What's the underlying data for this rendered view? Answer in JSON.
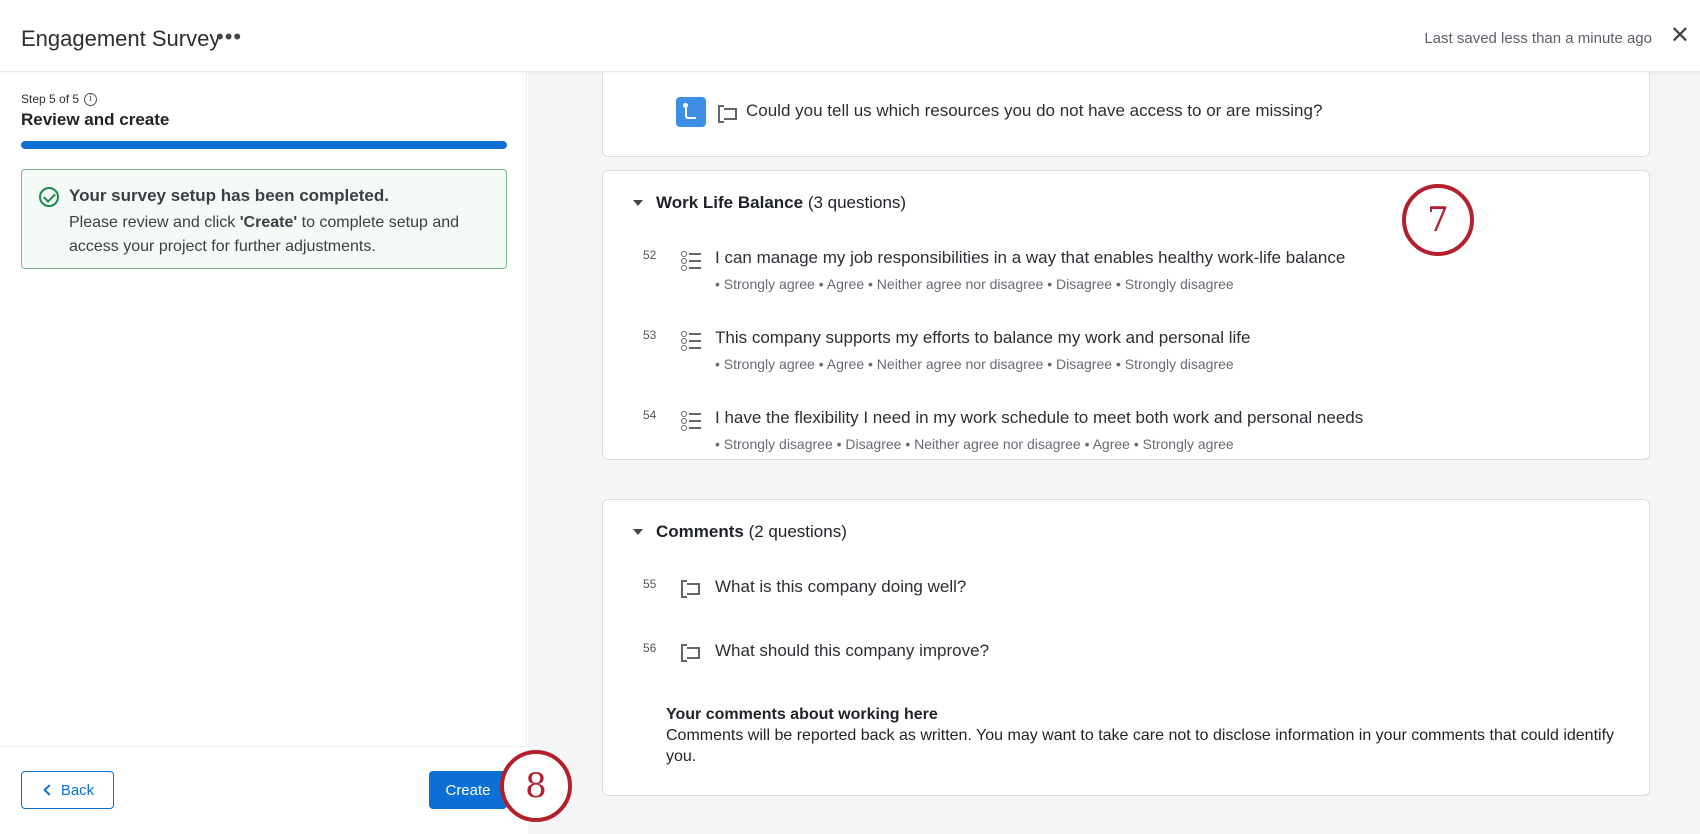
{
  "header": {
    "title": "Engagement Survey",
    "more_icon": "more-horizontal-icon",
    "more_glyph": "•••",
    "saved_status": "Last saved less than a minute ago",
    "close_icon": "close-icon",
    "close_glyph": "✕"
  },
  "wizard": {
    "step_label": "Step 5 of 5",
    "step_title": "Review and create",
    "progress": 1.0,
    "success_title": "Your survey setup has been completed.",
    "success_body_pre": "Please review and click ",
    "success_body_bold": "'Create'",
    "success_body_post": " to complete setup and access your project for further adjustments.",
    "back_label": "Back",
    "create_label": "Create"
  },
  "top_card": {
    "question": "Could you tell us which resources you do not have access to or are missing?"
  },
  "sections": {
    "wlb": {
      "name": "Work Life Balance",
      "count": "(3 questions)",
      "questions": [
        {
          "num": "52",
          "text": "I can manage my job responsibilities in a way that enables healthy work-life balance",
          "choices": "• Strongly agree • Agree • Neither agree nor disagree • Disagree • Strongly disagree"
        },
        {
          "num": "53",
          "text": "This company supports my efforts to balance my work and personal life",
          "choices": "• Strongly agree • Agree • Neither agree nor disagree • Disagree • Strongly disagree"
        },
        {
          "num": "54",
          "text": "I have the flexibility I need in my work schedule to meet both work and personal needs",
          "choices": "• Strongly disagree • Disagree • Neither agree nor disagree • Agree • Strongly agree"
        }
      ]
    },
    "comments": {
      "name": "Comments",
      "count": "(2 questions)",
      "questions": [
        {
          "num": "55",
          "text": "What is this company doing well?"
        },
        {
          "num": "56",
          "text": "What should this company improve?"
        }
      ],
      "note_title": "Your comments about working here",
      "note_body": "Comments will be reported back as written. You may want to take care not to disclose information in your comments that could identify you."
    }
  },
  "markers": {
    "seven": "7",
    "eight": "8"
  },
  "colors": {
    "accent": "#0b6fd6",
    "success": "#1e8a4f",
    "marker": "#b21f2d"
  }
}
